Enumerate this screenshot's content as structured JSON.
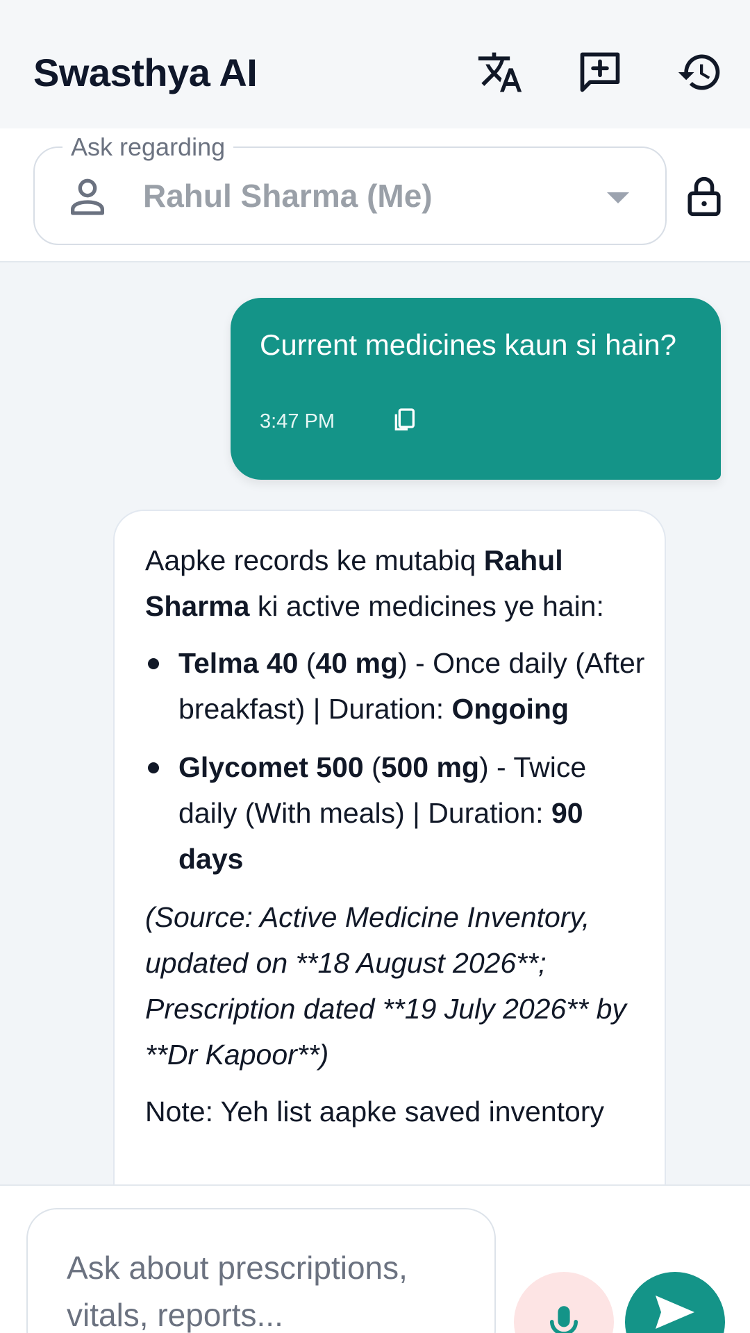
{
  "header": {
    "title": "Swasthya AI",
    "icons": [
      "translate-icon",
      "new-chat-icon",
      "history-icon"
    ]
  },
  "selector": {
    "legend": "Ask regarding",
    "value": "Rahul Sharma (Me)",
    "icons": [
      "person-icon",
      "dropdown-caret-icon",
      "lock-icon"
    ]
  },
  "chat": {
    "user_message": {
      "text": "Current medicines kaun si hain?",
      "time": "3:47 PM"
    },
    "bot_message": {
      "intro_pre": "Aapke records ke mutabiq ",
      "intro_name": "Rahul Sharma",
      "intro_post": " ki active medicines ye hain:",
      "medicines": [
        {
          "name": "Telma 40",
          "dose": "40 mg",
          "freq": " - Once daily (After breakfast) | Duration: ",
          "duration": "Ongoing"
        },
        {
          "name": "Glycomet 500",
          "dose": "500 mg",
          "freq": " - Twice daily (With meals) | Duration: ",
          "duration": "90 days"
        }
      ],
      "source": "(Source: Active Medicine Inventory, updated on **18 August 2026**; Prescription dated **19 July 2026** by **Dr Kapoor**)",
      "note": "Note: Yeh list aapke saved inventory"
    }
  },
  "input": {
    "placeholder": "Ask about prescriptions, vitals, reports..."
  },
  "colors": {
    "accent": "#149488",
    "mic_bg": "#fde4e4",
    "mic_icon": "#149488"
  }
}
